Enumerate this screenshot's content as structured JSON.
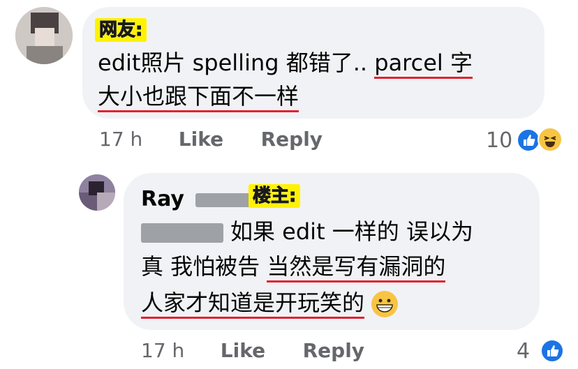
{
  "comment": {
    "badge": "网友:",
    "line1_pre": "edit照片 spelling 都错了.. ",
    "line1_ul": "parcel 字",
    "line2_ul": "大小也跟下面不一样",
    "time": "17 h",
    "like_label": "Like",
    "reply_label": "Reply",
    "reaction_count": "10",
    "reaction_icons": [
      "like-icon",
      "haha-icon"
    ]
  },
  "reply": {
    "author_name": "Ray",
    "badge": "楼主:",
    "line1_text": "如果 edit 一样的 误以为",
    "line2_pre": "真 我怕被告 ",
    "line2_ul": "当然是写有漏洞的",
    "line3_ul": "人家才知道是开玩笑的",
    "emoji": "grinning-face-icon",
    "time": "17 h",
    "like_label": "Like",
    "reply_label": "Reply",
    "reaction_count": "4",
    "reaction_icons": [
      "like-icon"
    ]
  },
  "colors": {
    "bubble": "#f0f2f5",
    "underline": "#e3212f",
    "badge_bg": "#fff200",
    "meta": "#65676b",
    "like_blue": "#1b74e4"
  }
}
